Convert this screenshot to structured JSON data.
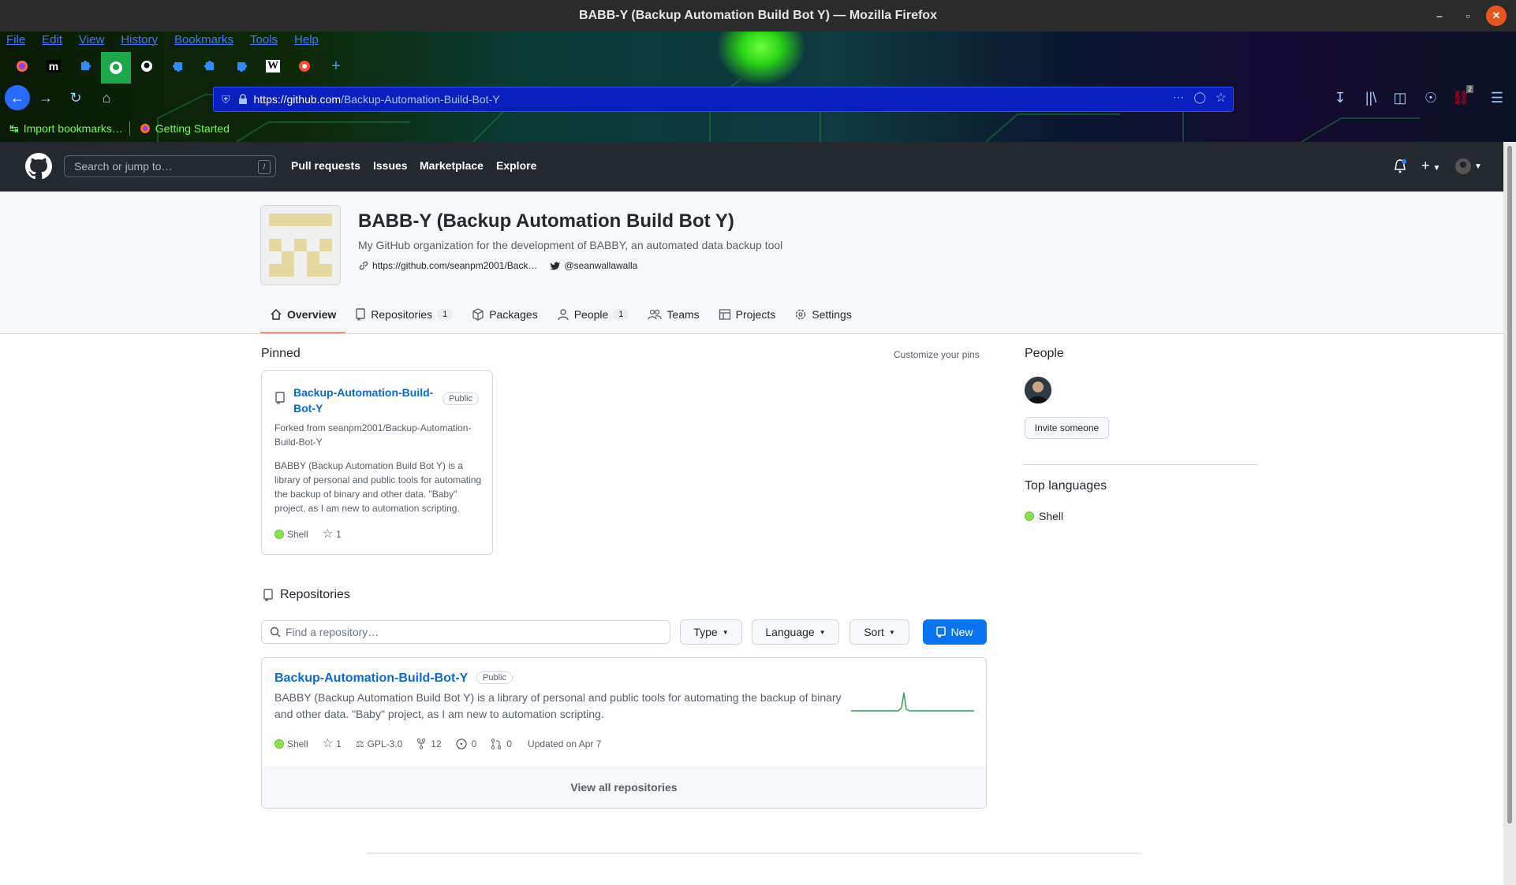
{
  "window": {
    "title": "BABB-Y (Backup Automation Build Bot Y) — Mozilla Firefox"
  },
  "menu": [
    "File",
    "Edit",
    "View",
    "History",
    "Bookmarks",
    "Tools",
    "Help"
  ],
  "browser": {
    "tabs": [
      {
        "icon": "firefox-icon"
      },
      {
        "icon": "m-icon",
        "text": "m"
      },
      {
        "icon": "puzzle-icon"
      },
      {
        "icon": "github-icon",
        "active": true
      },
      {
        "icon": "github-icon"
      },
      {
        "icon": "puzzle-icon"
      },
      {
        "icon": "puzzle-icon"
      },
      {
        "icon": "puzzle-icon"
      },
      {
        "icon": "wikipedia-icon",
        "text": "W"
      },
      {
        "icon": "brave-icon"
      },
      {
        "icon": "new-tab-icon",
        "text": "+"
      }
    ],
    "url_domain": "https://github.com",
    "url_path": "/Backup-Automation-Build-Bot-Y",
    "ublock_count": "2",
    "bookmarks": [
      "Import bookmarks…",
      "Getting Started"
    ]
  },
  "github": {
    "search_placeholder": "Search or jump to…",
    "search_key": "/",
    "nav": [
      "Pull requests",
      "Issues",
      "Marketplace",
      "Explore"
    ]
  },
  "org": {
    "name": "BABB-Y (Backup Automation Build Bot Y)",
    "description": "My GitHub organization for the development of BABBY, an automated data backup tool",
    "website": "https://github.com/seanpm2001/Back…",
    "twitter": "@seanwallawalla",
    "tabs": [
      {
        "label": "Overview",
        "icon": "home-icon"
      },
      {
        "label": "Repositories",
        "icon": "repo-icon",
        "count": "1"
      },
      {
        "label": "Packages",
        "icon": "package-icon"
      },
      {
        "label": "People",
        "icon": "person-icon",
        "count": "1"
      },
      {
        "label": "Teams",
        "icon": "people-icon"
      },
      {
        "label": "Projects",
        "icon": "table-icon"
      },
      {
        "label": "Settings",
        "icon": "gear-icon"
      }
    ]
  },
  "pinned": {
    "title": "Pinned",
    "customize": "Customize your pins",
    "card": {
      "name_line1": "Backup-Automation-Build-",
      "name_line2": "Bot-Y",
      "visibility": "Public",
      "fork_line1": "Forked from seanpm2001/Backup-Automation-",
      "fork_line2": "Build-Bot-Y",
      "desc_lines": [
        "BABBY (Backup Automation Build Bot Y) is a",
        "library of personal and public tools for automating",
        "the backup of binary and other data. \"Baby\"",
        "project, as I am new to automation scripting."
      ],
      "language": "Shell",
      "stars": "1"
    }
  },
  "repositories": {
    "title": "Repositories",
    "find_placeholder": "Find a repository…",
    "type_label": "Type",
    "language_label": "Language",
    "sort_label": "Sort",
    "new_label": "New",
    "repo": {
      "name": "Backup-Automation-Build-Bot-Y",
      "visibility": "Public",
      "desc_line1": "BABBY (Backup Automation Build Bot Y) is a library of personal and public tools for automating the backup of binary",
      "desc_line2": "and other data. \"Baby\" project, as I am new to automation scripting.",
      "language": "Shell",
      "stars": "1",
      "license": "GPL-3.0",
      "forks": "12",
      "issues": "0",
      "pulls": "0",
      "updated": "Updated on Apr 7"
    },
    "view_all": "View all repositories"
  },
  "sidebar": {
    "people_title": "People",
    "invite": "Invite someone",
    "top_languages_title": "Top languages",
    "language": "Shell"
  },
  "colors": {
    "shell": "#89e051",
    "link": "#0969da",
    "primary_button": "#0a74f0",
    "header": "#24292f"
  }
}
